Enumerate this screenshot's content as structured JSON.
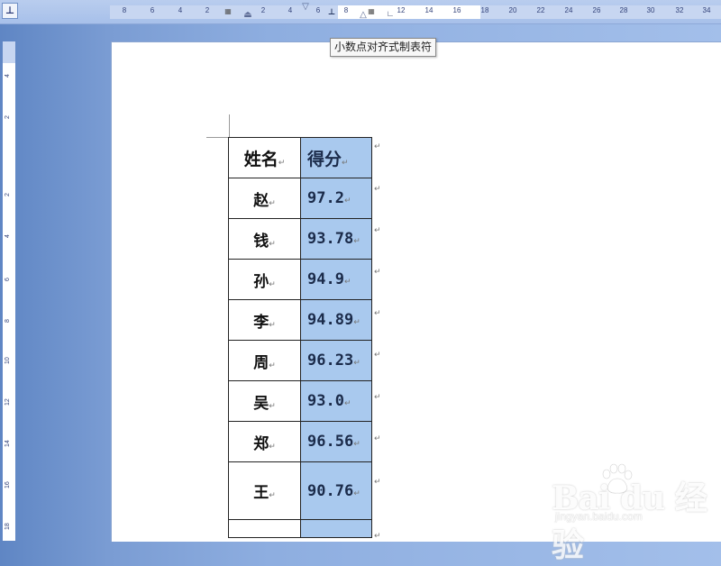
{
  "tab_selector": {
    "glyph": "⊥"
  },
  "ruler": {
    "left_numbers": [
      "8",
      "6",
      "4",
      "2"
    ],
    "inner_numbers": [
      "2",
      "4",
      "6",
      "8"
    ],
    "right_numbers": [
      "12",
      "14",
      "16",
      "18",
      "20",
      "22",
      "24",
      "26",
      "28",
      "30",
      "32",
      "34"
    ],
    "vertical_numbers": [
      "4",
      "2",
      "2",
      "4",
      "6",
      "8",
      "10",
      "12",
      "14",
      "16",
      "18"
    ]
  },
  "tooltip": {
    "text": "小数点对齐式制表符"
  },
  "table": {
    "header": {
      "name": "姓名",
      "score": "得分"
    },
    "rows": [
      {
        "name": "赵",
        "score": "97.2"
      },
      {
        "name": "钱",
        "score": "93.78"
      },
      {
        "name": "孙",
        "score": "94.9"
      },
      {
        "name": "李",
        "score": "94.89"
      },
      {
        "name": "周",
        "score": "96.23"
      },
      {
        "name": "吴",
        "score": "93.0"
      },
      {
        "name": "郑",
        "score": "96.56"
      },
      {
        "name": "王",
        "score": "90.76"
      }
    ],
    "paragraph_mark": "↵"
  },
  "watermark": {
    "logo": "Bai du 经验",
    "site": "jingyan.baidu.com"
  },
  "colors": {
    "score_highlight": "#a9c9ee",
    "ruler": "#c7d6f1",
    "background": "#8eaee0"
  }
}
